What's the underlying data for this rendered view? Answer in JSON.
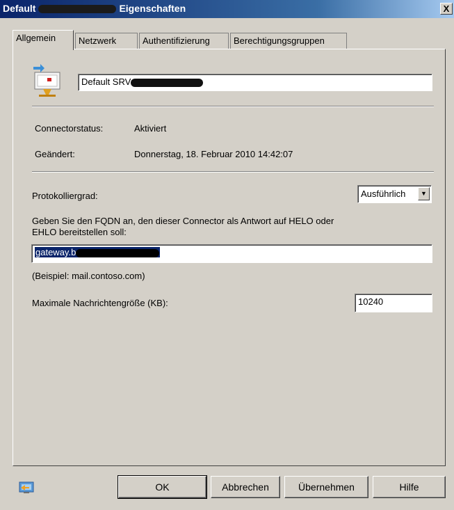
{
  "window": {
    "title_prefix": "Default",
    "title_suffix": "Eigenschaften",
    "close_label": "X"
  },
  "tabs": [
    {
      "label": "Allgemein"
    },
    {
      "label": "Netzwerk"
    },
    {
      "label": "Authentifizierung"
    },
    {
      "label": "Berechtigungsgruppen"
    }
  ],
  "general": {
    "connector_name": "Default SRV",
    "status_label": "Connectorstatus:",
    "status_value": "Aktiviert",
    "changed_label": "Geändert:",
    "changed_value": "Donnerstag, 18. Februar 2010 14:42:07",
    "log_level_label": "Protokolliergrad:",
    "log_level_value": "Ausführlich",
    "fqdn_prompt_line1": "Geben Sie den FQDN an, den dieser Connector als Antwort auf HELO oder",
    "fqdn_prompt_line2": "EHLO bereitstellen soll:",
    "fqdn_value": "gateway.b",
    "fqdn_example": "(Beispiel: mail.contoso.com)",
    "max_size_label": "Maximale Nachrichtengröße (KB):",
    "max_size_value": "10240"
  },
  "buttons": {
    "ok": "OK",
    "cancel": "Abbrechen",
    "apply": "Übernehmen",
    "help": "Hilfe"
  }
}
